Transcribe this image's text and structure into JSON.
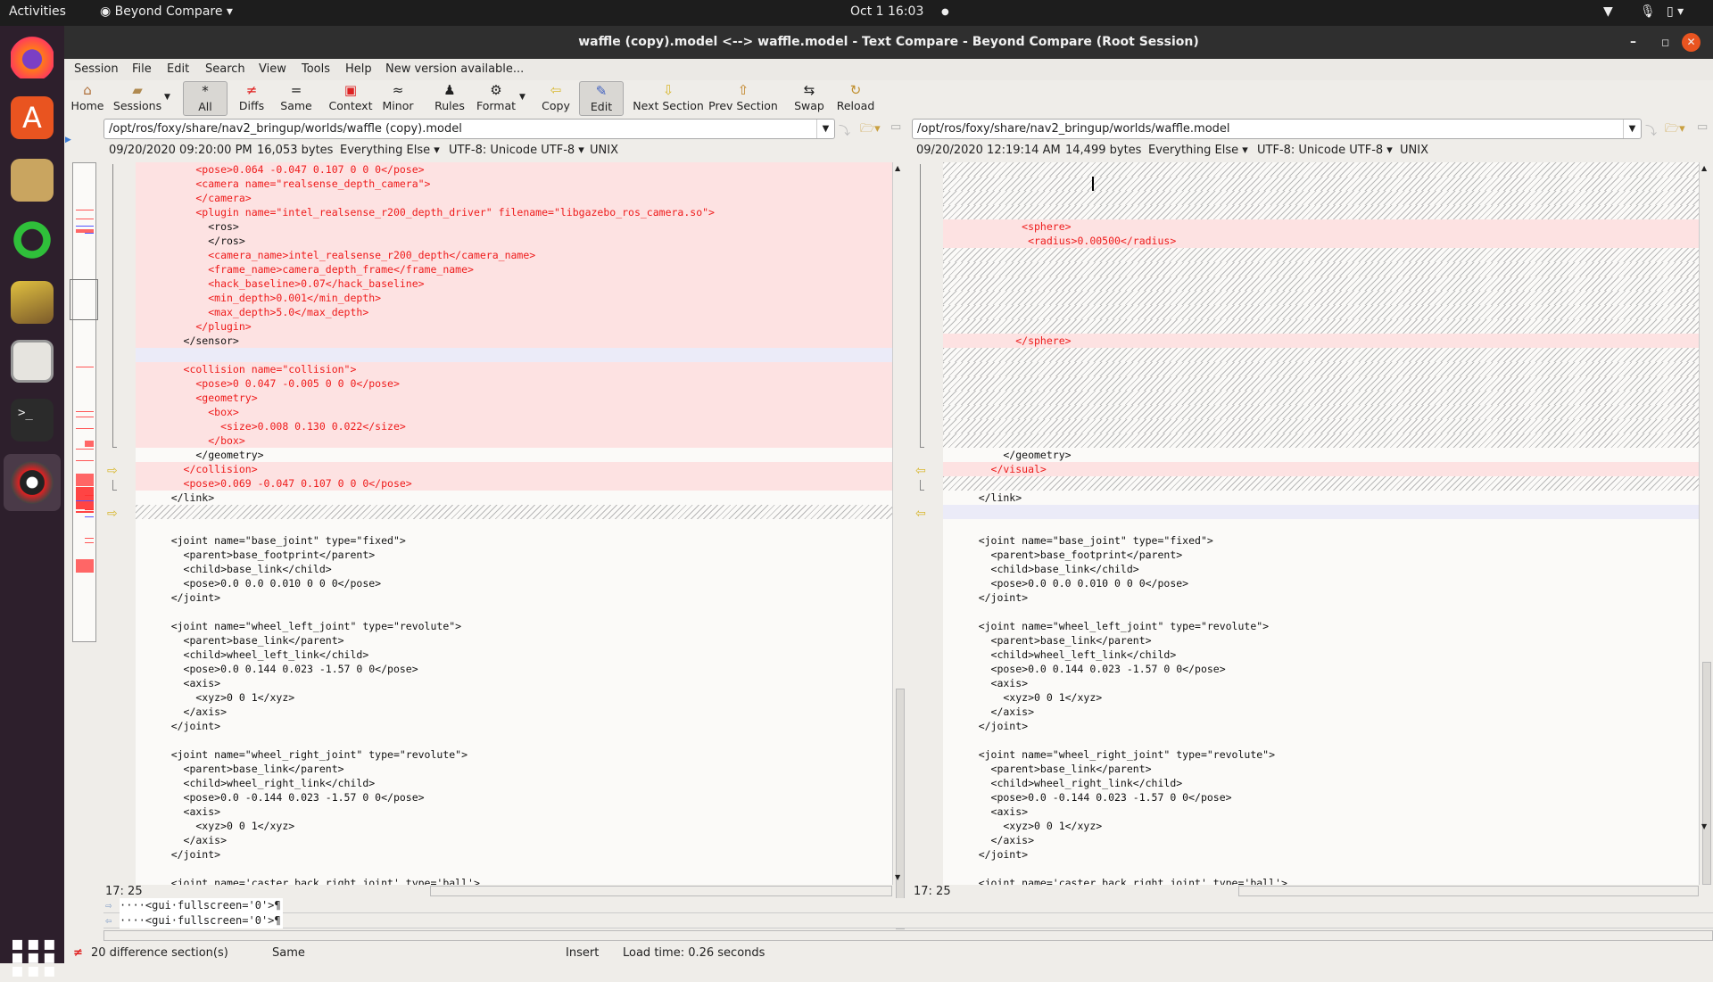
{
  "topbar": {
    "activities": "Activities",
    "app": "Beyond Compare",
    "clock": "Oct 1  16:03"
  },
  "window": {
    "title": "waffle (copy).model <--> waffle.model - Text Compare - Beyond Compare (Root Session)"
  },
  "menu": [
    "Session",
    "File",
    "Edit",
    "Search",
    "View",
    "Tools",
    "Help",
    "New version available..."
  ],
  "toolbar": [
    {
      "label": "Home",
      "icon": "home-icon"
    },
    {
      "label": "Sessions",
      "icon": "sessions-icon"
    },
    {
      "label": "All",
      "icon": "asterisk-icon",
      "pressed": true
    },
    {
      "label": "Diffs",
      "icon": "not-equal-icon"
    },
    {
      "label": "Same",
      "icon": "equal-icon"
    },
    {
      "label": "Context",
      "icon": "context-icon"
    },
    {
      "label": "Minor",
      "icon": "approx-icon"
    },
    {
      "label": "Rules",
      "icon": "referee-icon"
    },
    {
      "label": "Format",
      "icon": "format-icon"
    },
    {
      "label": "Copy",
      "icon": "arrow-left-icon"
    },
    {
      "label": "Edit",
      "icon": "pencil-icon",
      "pressed": true
    },
    {
      "label": "Next Section",
      "icon": "arrow-down-icon"
    },
    {
      "label": "Prev Section",
      "icon": "arrow-up-icon"
    },
    {
      "label": "Swap",
      "icon": "swap-icon"
    },
    {
      "label": "Reload",
      "icon": "reload-icon"
    }
  ],
  "left": {
    "path": "/opt/ros/foxy/share/nav2_bringup/worlds/waffle (copy).model",
    "date": "09/20/2020 09:20:00 PM",
    "size": "16,053 bytes",
    "format": "Everything Else",
    "encoding": "UTF-8: Unicode UTF-8",
    "eol": "UNIX",
    "position": "17: 25",
    "rows": [
      {
        "t": "        <pose>0.064 -0.047 0.107 0 0 0</pose>",
        "k": "r"
      },
      {
        "t": "        <camera name=\"realsense_depth_camera\">",
        "k": "r"
      },
      {
        "t": "        </camera>",
        "k": "r"
      },
      {
        "t": "        <plugin name=\"intel_realsense_r200_depth_driver\" filename=\"libgazebo_ros_camera.so\">",
        "k": "r"
      },
      {
        "t": "          <ros>",
        "k": "rk"
      },
      {
        "t": "          </ros>",
        "k": "rk"
      },
      {
        "t": "          <camera_name>intel_realsense_r200_depth</camera_name>",
        "k": "r"
      },
      {
        "t": "          <frame_name>camera_depth_frame</frame_name>",
        "k": "r"
      },
      {
        "t": "          <hack_baseline>0.07</hack_baseline>",
        "k": "r"
      },
      {
        "t": "          <min_depth>0.001</min_depth>",
        "k": "r"
      },
      {
        "t": "          <max_depth>5.0</max_depth>",
        "k": "r"
      },
      {
        "t": "        </plugin>",
        "k": "r"
      },
      {
        "t": "      </sensor>",
        "k": "rk"
      },
      {
        "t": "",
        "k": "b"
      },
      {
        "t": "      <collision name=\"collision\">",
        "k": "r"
      },
      {
        "t": "        <pose>0 0.047 -0.005 0 0 0</pose>",
        "k": "r"
      },
      {
        "t": "        <geometry>",
        "k": "r"
      },
      {
        "t": "          <box>",
        "k": "r"
      },
      {
        "t": "            <size>0.008 0.130 0.022</size>",
        "k": "r"
      },
      {
        "t": "          </box>",
        "k": "r"
      },
      {
        "t": "        </geometry>",
        "k": "w"
      },
      {
        "t": "      </collision>",
        "k": "r"
      },
      {
        "t": "      <pose>0.069 -0.047 0.107 0 0 0</pose>",
        "k": "r"
      },
      {
        "t": "    </link>",
        "k": "w"
      },
      {
        "t": "",
        "k": "h"
      },
      {
        "t": "",
        "k": "w"
      },
      {
        "t": "    <joint name=\"base_joint\" type=\"fixed\">",
        "k": "w"
      },
      {
        "t": "      <parent>base_footprint</parent>",
        "k": "w"
      },
      {
        "t": "      <child>base_link</child>",
        "k": "w"
      },
      {
        "t": "      <pose>0.0 0.0 0.010 0 0 0</pose>",
        "k": "w"
      },
      {
        "t": "    </joint>",
        "k": "w"
      },
      {
        "t": "",
        "k": "w"
      },
      {
        "t": "    <joint name=\"wheel_left_joint\" type=\"revolute\">",
        "k": "w"
      },
      {
        "t": "      <parent>base_link</parent>",
        "k": "w"
      },
      {
        "t": "      <child>wheel_left_link</child>",
        "k": "w"
      },
      {
        "t": "      <pose>0.0 0.144 0.023 -1.57 0 0</pose>",
        "k": "w"
      },
      {
        "t": "      <axis>",
        "k": "w"
      },
      {
        "t": "        <xyz>0 0 1</xyz>",
        "k": "w"
      },
      {
        "t": "      </axis>",
        "k": "w"
      },
      {
        "t": "    </joint>",
        "k": "w"
      },
      {
        "t": "",
        "k": "w"
      },
      {
        "t": "    <joint name=\"wheel_right_joint\" type=\"revolute\">",
        "k": "w"
      },
      {
        "t": "      <parent>base_link</parent>",
        "k": "w"
      },
      {
        "t": "      <child>wheel_right_link</child>",
        "k": "w"
      },
      {
        "t": "      <pose>0.0 -0.144 0.023 -1.57 0 0</pose>",
        "k": "w"
      },
      {
        "t": "      <axis>",
        "k": "w"
      },
      {
        "t": "        <xyz>0 0 1</xyz>",
        "k": "w"
      },
      {
        "t": "      </axis>",
        "k": "w"
      },
      {
        "t": "    </joint>",
        "k": "w"
      },
      {
        "t": "",
        "k": "w"
      },
      {
        "t": "    <joint name='caster_back_right_joint' type='ball'>",
        "k": "w"
      }
    ]
  },
  "right": {
    "path": "/opt/ros/foxy/share/nav2_bringup/worlds/waffle.model",
    "date": "09/20/2020 12:19:14 AM",
    "size": "14,499 bytes",
    "format": "Everything Else",
    "encoding": "UTF-8: Unicode UTF-8",
    "eol": "UNIX",
    "position": "17: 25",
    "rows": [
      {
        "t": "",
        "k": "h"
      },
      {
        "t": "",
        "k": "h"
      },
      {
        "t": "",
        "k": "h"
      },
      {
        "t": "",
        "k": "h"
      },
      {
        "t": "           <sphere>",
        "k": "r"
      },
      {
        "t": "            <radius>0.00500</radius>",
        "k": "r"
      },
      {
        "t": "",
        "k": "h"
      },
      {
        "t": "",
        "k": "h"
      },
      {
        "t": "",
        "k": "h"
      },
      {
        "t": "",
        "k": "h"
      },
      {
        "t": "",
        "k": "h"
      },
      {
        "t": "",
        "k": "h"
      },
      {
        "t": "          </sphere>",
        "k": "r"
      },
      {
        "t": "",
        "k": "h"
      },
      {
        "t": "",
        "k": "h"
      },
      {
        "t": "",
        "k": "h"
      },
      {
        "t": "",
        "k": "h"
      },
      {
        "t": "",
        "k": "h"
      },
      {
        "t": "",
        "k": "h"
      },
      {
        "t": "",
        "k": "h"
      },
      {
        "t": "        </geometry>",
        "k": "w"
      },
      {
        "t": "      </visual>",
        "k": "r"
      },
      {
        "t": "",
        "k": "h"
      },
      {
        "t": "    </link>",
        "k": "w"
      },
      {
        "t": "",
        "k": "b"
      },
      {
        "t": "",
        "k": "w"
      },
      {
        "t": "    <joint name=\"base_joint\" type=\"fixed\">",
        "k": "w"
      },
      {
        "t": "      <parent>base_footprint</parent>",
        "k": "w"
      },
      {
        "t": "      <child>base_link</child>",
        "k": "w"
      },
      {
        "t": "      <pose>0.0 0.0 0.010 0 0 0</pose>",
        "k": "w"
      },
      {
        "t": "    </joint>",
        "k": "w"
      },
      {
        "t": "",
        "k": "w"
      },
      {
        "t": "    <joint name=\"wheel_left_joint\" type=\"revolute\">",
        "k": "w"
      },
      {
        "t": "      <parent>base_link</parent>",
        "k": "w"
      },
      {
        "t": "      <child>wheel_left_link</child>",
        "k": "w"
      },
      {
        "t": "      <pose>0.0 0.144 0.023 -1.57 0 0</pose>",
        "k": "w"
      },
      {
        "t": "      <axis>",
        "k": "w"
      },
      {
        "t": "        <xyz>0 0 1</xyz>",
        "k": "w"
      },
      {
        "t": "      </axis>",
        "k": "w"
      },
      {
        "t": "    </joint>",
        "k": "w"
      },
      {
        "t": "",
        "k": "w"
      },
      {
        "t": "    <joint name=\"wheel_right_joint\" type=\"revolute\">",
        "k": "w"
      },
      {
        "t": "      <parent>base_link</parent>",
        "k": "w"
      },
      {
        "t": "      <child>wheel_right_link</child>",
        "k": "w"
      },
      {
        "t": "      <pose>0.0 -0.144 0.023 -1.57 0 0</pose>",
        "k": "w"
      },
      {
        "t": "      <axis>",
        "k": "w"
      },
      {
        "t": "        <xyz>0 0 1</xyz>",
        "k": "w"
      },
      {
        "t": "      </axis>",
        "k": "w"
      },
      {
        "t": "    </joint>",
        "k": "w"
      },
      {
        "t": "",
        "k": "w"
      },
      {
        "t": "    <joint name='caster_back_right_joint' type='ball'>",
        "k": "w"
      }
    ]
  },
  "compare": {
    "left_line": "····<gui·fullscreen='0'>¶",
    "right_line": "····<gui·fullscreen='0'>¶"
  },
  "status": {
    "diffs": "20 difference section(s)",
    "same": "Same",
    "mode": "Insert",
    "load": "Load time: 0.26 seconds"
  },
  "colors": {
    "diff_bg": "#fde2e2",
    "diff_text": "#ee1b1b",
    "missing_bg": "#ebebf8",
    "close": "#e95420"
  }
}
